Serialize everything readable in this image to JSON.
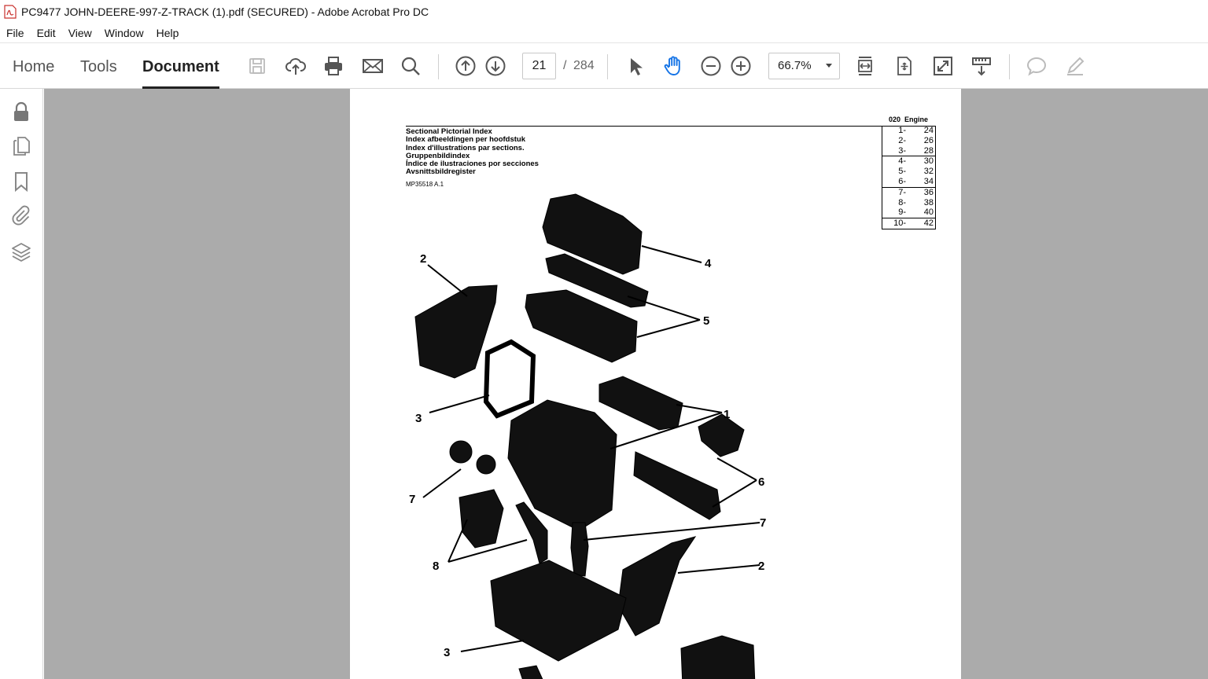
{
  "window": {
    "title": "PC9477 JOHN-DEERE-997-Z-TRACK (1).pdf (SECURED) - Adobe Acrobat Pro DC"
  },
  "menu": [
    "File",
    "Edit",
    "View",
    "Window",
    "Help"
  ],
  "tabs": {
    "home": "Home",
    "tools": "Tools",
    "document": "Document"
  },
  "toolbar": {
    "current_page": "21",
    "page_separator": "/",
    "total_pages": "284",
    "zoom": "66.7%"
  },
  "document": {
    "section_code": "020",
    "section_name": "Engine",
    "titles": [
      "Sectional Pictorial Index",
      "Index afbeeldingen per hoofdstuk",
      "Index d'illustrations par sections.",
      "Gruppenbildindex",
      "Índice de ilustraciones por secciones",
      "Avsnittsbildregister"
    ],
    "reference": "MP35518 A.1",
    "index_groups": [
      [
        {
          "n": "1-",
          "p": "24"
        },
        {
          "n": "2-",
          "p": "26"
        },
        {
          "n": "3-",
          "p": "28"
        }
      ],
      [
        {
          "n": "4-",
          "p": "30"
        },
        {
          "n": "5-",
          "p": "32"
        },
        {
          "n": "6-",
          "p": "34"
        }
      ],
      [
        {
          "n": "7-",
          "p": "36"
        },
        {
          "n": "8-",
          "p": "38"
        },
        {
          "n": "9-",
          "p": "40"
        }
      ],
      [
        {
          "n": "10-",
          "p": "42"
        }
      ]
    ],
    "callouts": [
      "4",
      "2",
      "5",
      "3",
      "1",
      "7",
      "6",
      "7",
      "8",
      "2",
      "3"
    ]
  }
}
